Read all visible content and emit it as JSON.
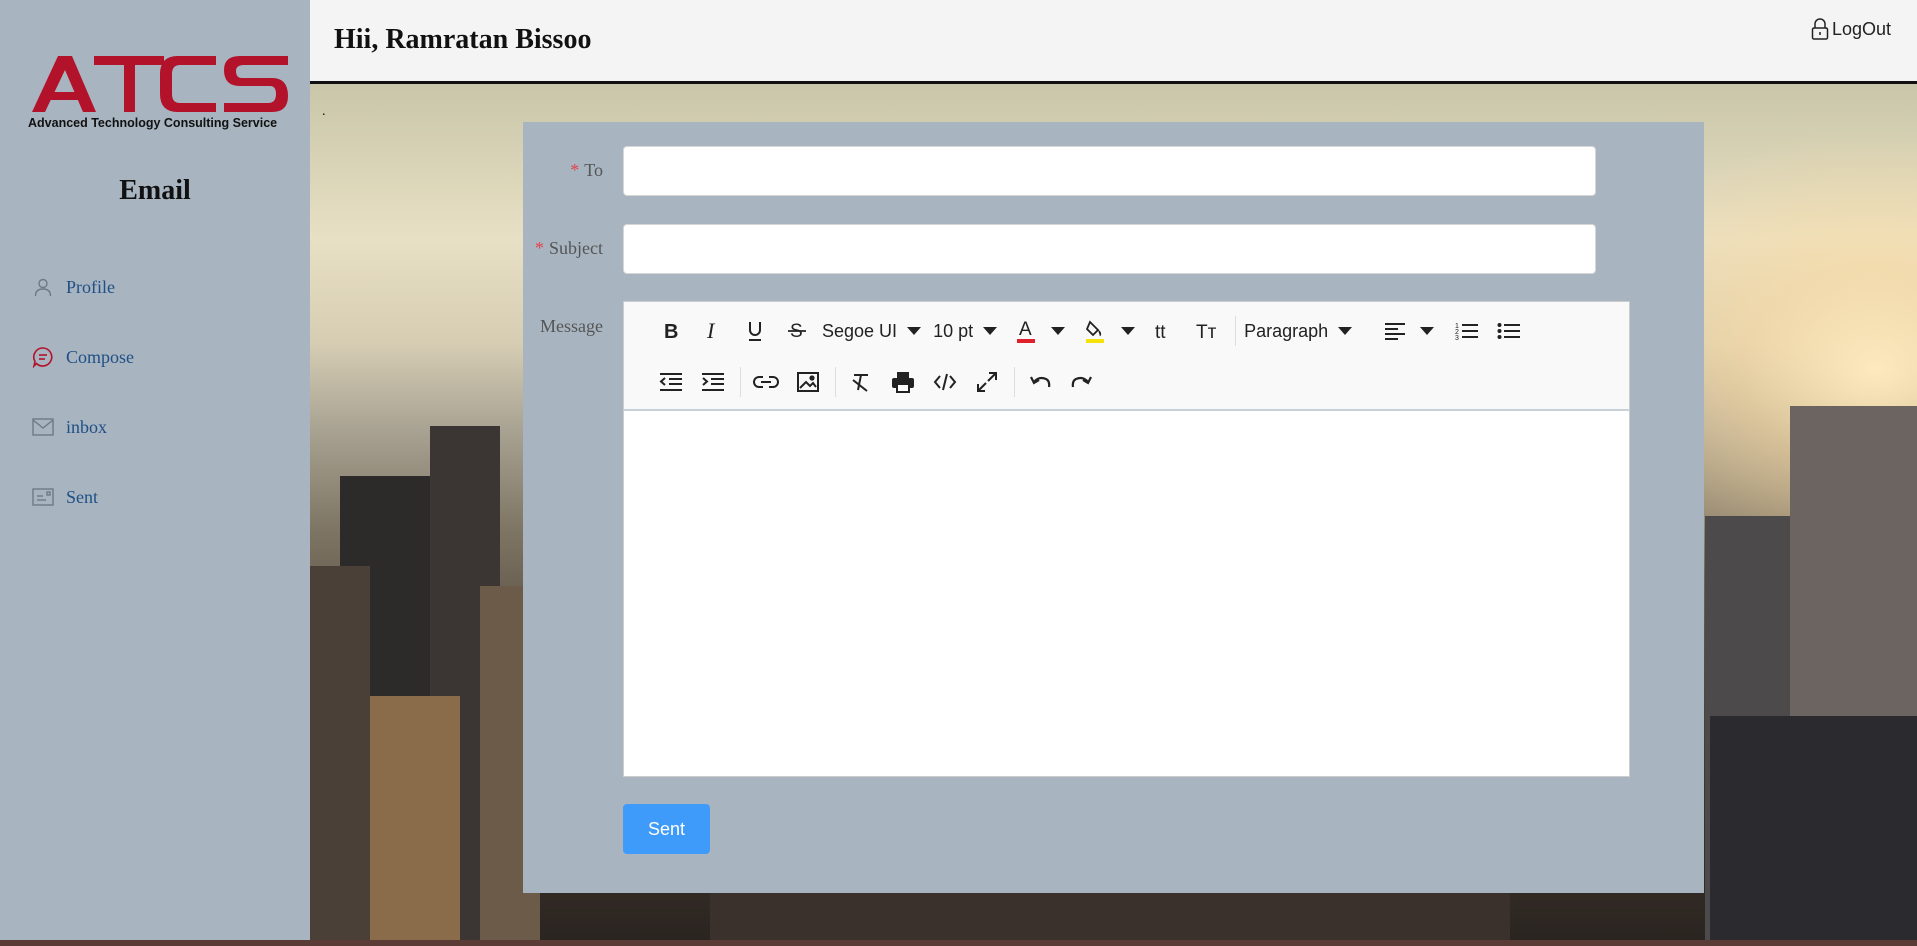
{
  "app": {
    "logo_text": "ATCS",
    "logo_tagline": "Advanced Technology Consulting Service",
    "brand_color": "#b2122a"
  },
  "sidebar": {
    "title": "Email",
    "items": [
      {
        "label": "Profile",
        "icon": "user-icon"
      },
      {
        "label": "Compose",
        "icon": "chat-bubble-icon"
      },
      {
        "label": "inbox",
        "icon": "mail-icon"
      },
      {
        "label": "Sent",
        "icon": "sent-card-icon"
      }
    ]
  },
  "header": {
    "greeting": "Hii, Ramratan Bissoo",
    "logout_label": "LogOut",
    "logout_icon": "lock-icon"
  },
  "compose": {
    "to_label": "To",
    "to_value": "",
    "subject_label": "Subject",
    "subject_value": "",
    "message_label": "Message",
    "required_marker": "*",
    "send_label": "Sent",
    "send_color": "#3f9bfa"
  },
  "editor": {
    "font_family": "Segoe UI",
    "font_size": "10 pt",
    "block_format": "Paragraph",
    "text_color": "#e0202a",
    "highlight_color": "#f4e20c",
    "toolbar_icons": [
      "bold-icon",
      "italic-icon",
      "underline-icon",
      "strikethrough-icon",
      "font-color-icon",
      "highlight-icon",
      "lowercase-icon",
      "uppercase-icon",
      "align-left-icon",
      "ordered-list-icon",
      "unordered-list-icon",
      "outdent-icon",
      "indent-icon",
      "link-icon",
      "image-icon",
      "clear-format-icon",
      "print-icon",
      "source-code-icon",
      "fullscreen-icon",
      "undo-icon",
      "redo-icon"
    ]
  }
}
